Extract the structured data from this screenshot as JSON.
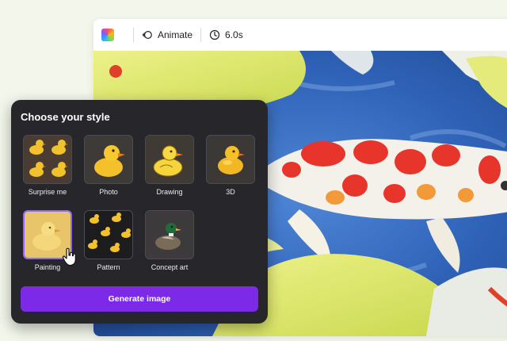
{
  "toolbar": {
    "animate_label": "Animate",
    "duration_label": "6.0s"
  },
  "panel": {
    "title": "Choose your style",
    "styles": [
      {
        "label": "Surprise me"
      },
      {
        "label": "Photo"
      },
      {
        "label": "Drawing"
      },
      {
        "label": "3D"
      },
      {
        "label": "Painting",
        "selected": true
      },
      {
        "label": "Pattern"
      },
      {
        "label": "Concept art"
      }
    ],
    "generate_label": "Generate image"
  },
  "colors": {
    "accent": "#7d2ae8",
    "selected_border": "#8b6cff",
    "panel_bg": "#27272b"
  },
  "icons": {
    "toolbar_logo": "color-swatch-icon",
    "animate": "animate-icon",
    "duration": "clock-icon",
    "pointer": "hand-pointer-icon"
  }
}
